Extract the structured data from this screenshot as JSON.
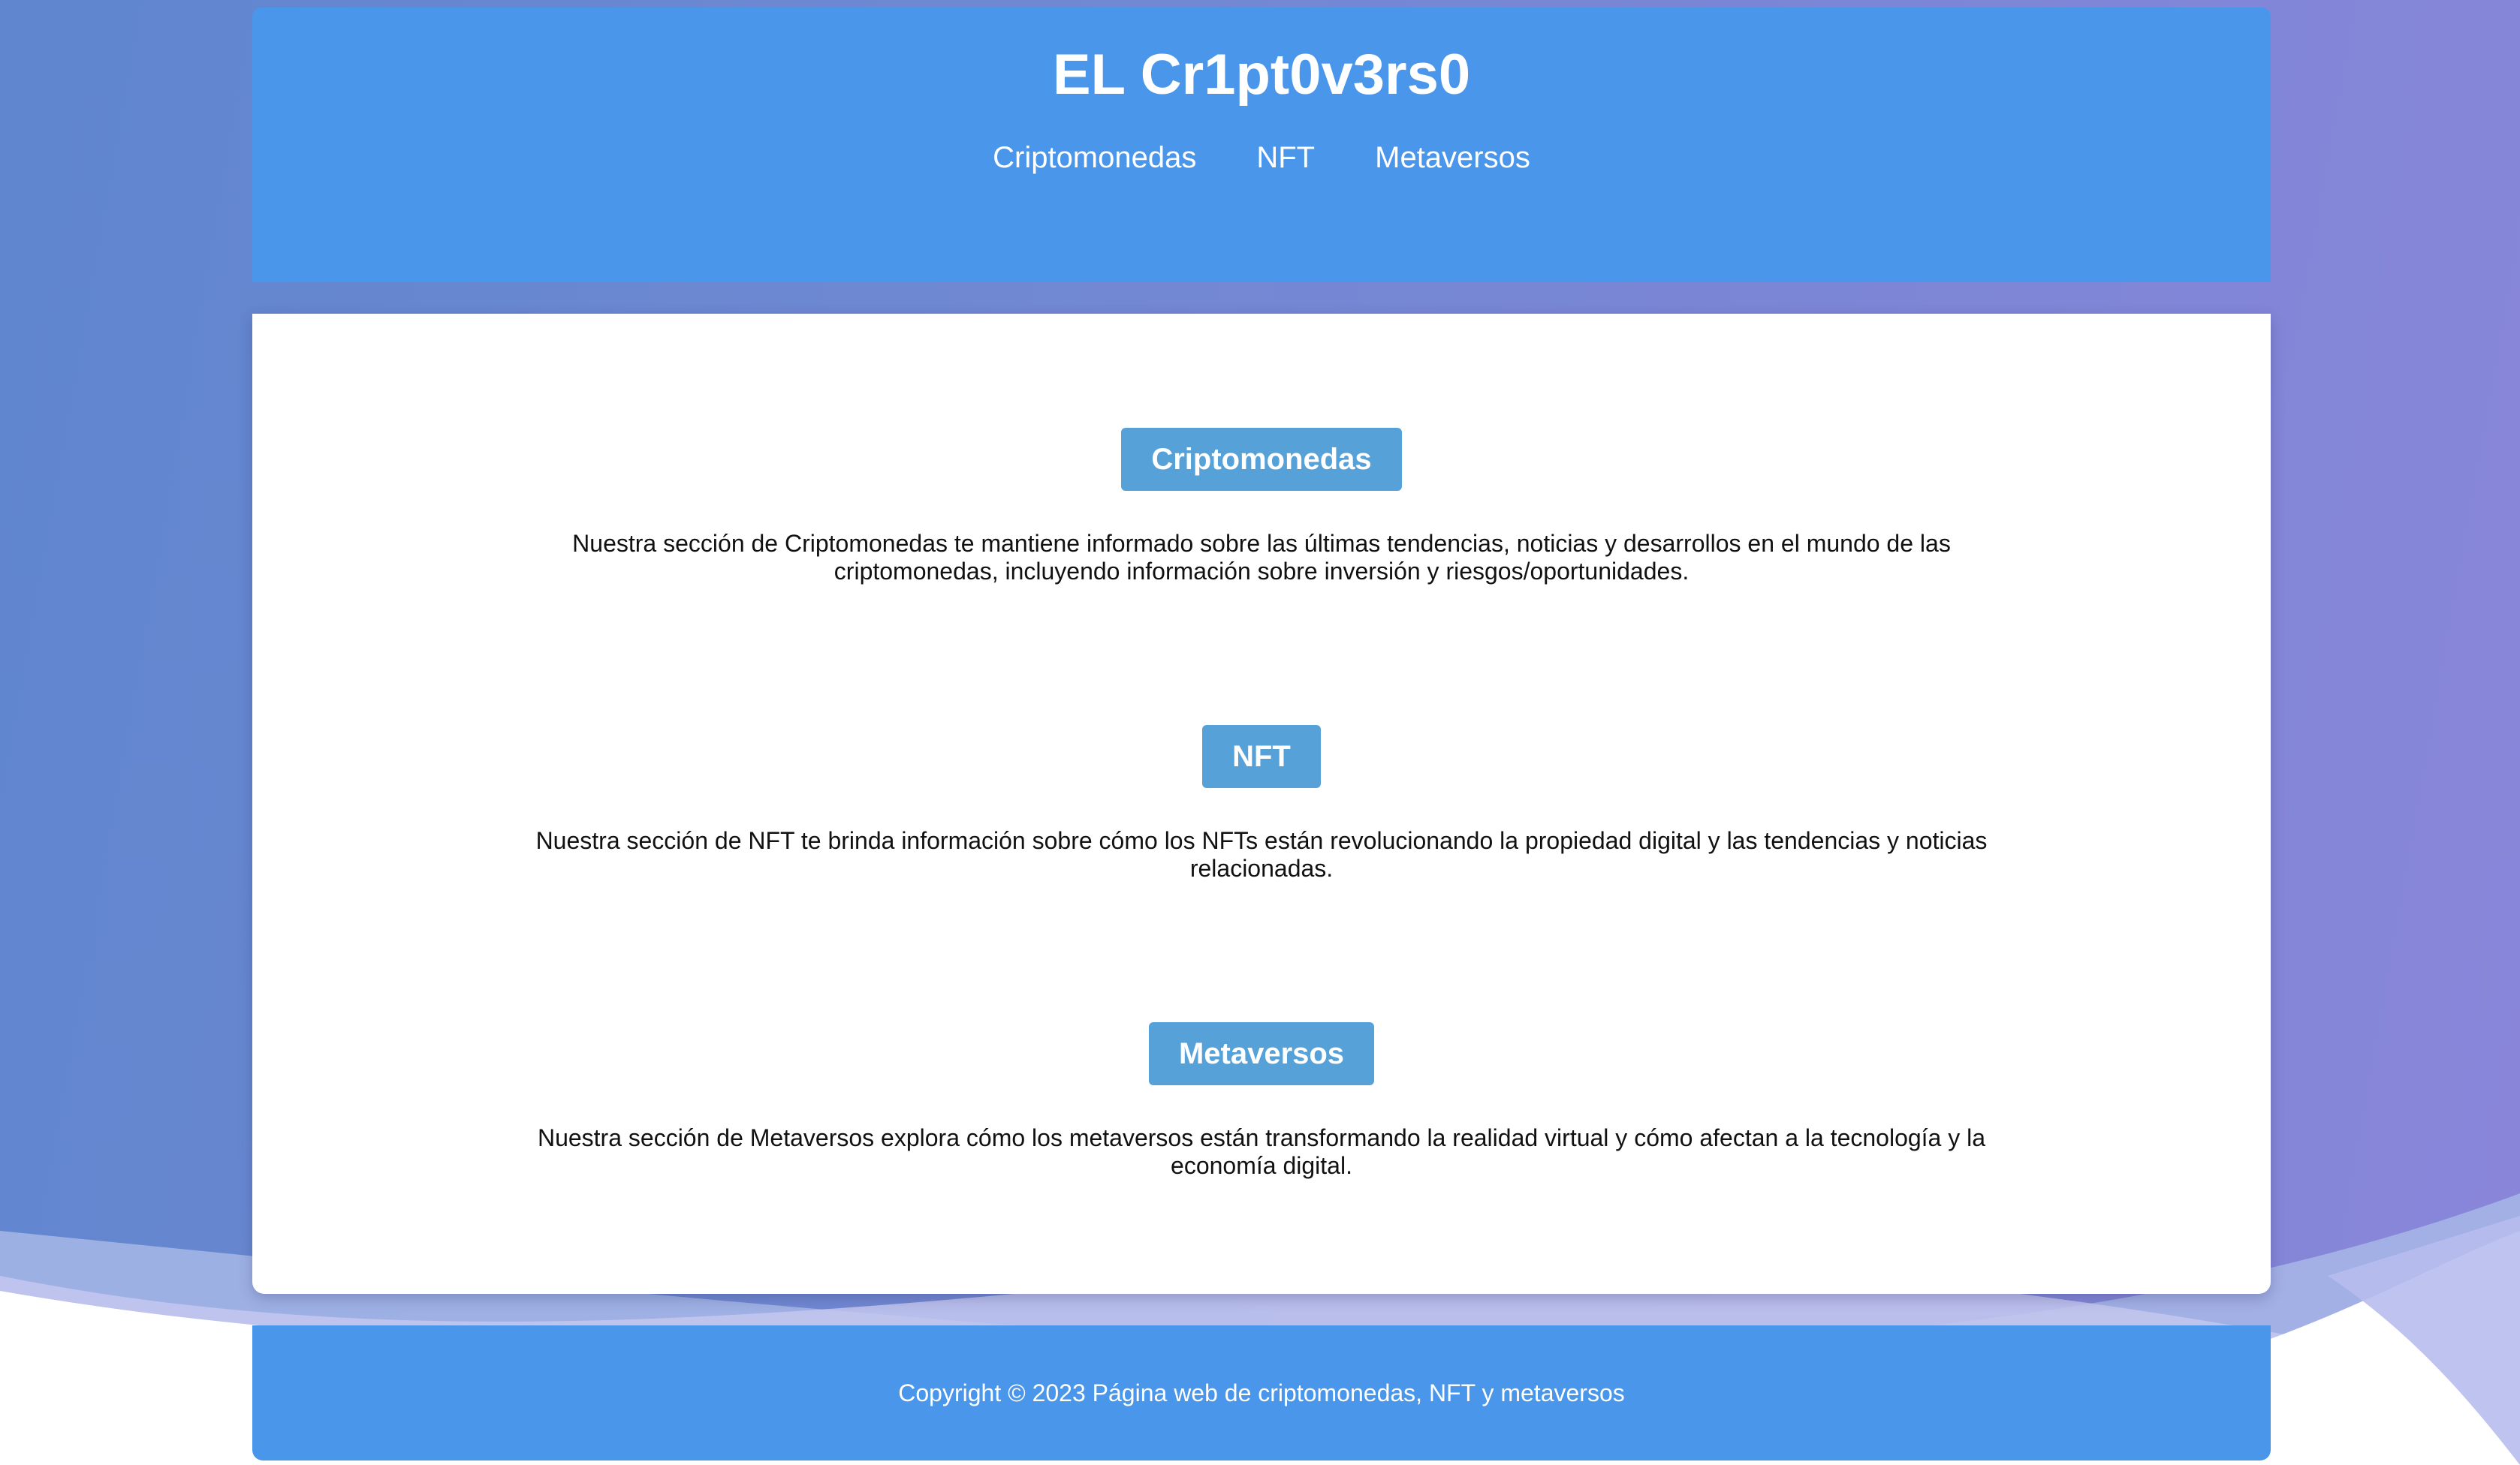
{
  "header": {
    "title": "EL Cr1pt0v3rs0",
    "nav": [
      {
        "label": "Criptomonedas"
      },
      {
        "label": "NFT"
      },
      {
        "label": "Metaversos"
      }
    ]
  },
  "sections": [
    {
      "heading": "Criptomonedas",
      "text": "Nuestra sección de Criptomonedas te mantiene informado sobre las últimas tendencias, noticias y desarrollos en el mundo de las criptomonedas, incluyendo información sobre inversión y riesgos/oportunidades."
    },
    {
      "heading": "NFT",
      "text": "Nuestra sección de NFT te brinda información sobre cómo los NFTs están revolucionando la propiedad digital y las tendencias y noticias relacionadas."
    },
    {
      "heading": "Metaversos",
      "text": "Nuestra sección de Metaversos explora cómo los metaversos están transformando la realidad virtual y cómo afectan a la tecnología y la economía digital."
    }
  ],
  "footer": {
    "copyright": "Copyright © 2023 Página web de criptomonedas, NFT y metaversos"
  },
  "colors": {
    "header_bg": "#4a96ea",
    "section_heading_bg": "#55a1d8",
    "background_gradient_start": "#5f86cf",
    "background_gradient_end": "#8a86da"
  }
}
